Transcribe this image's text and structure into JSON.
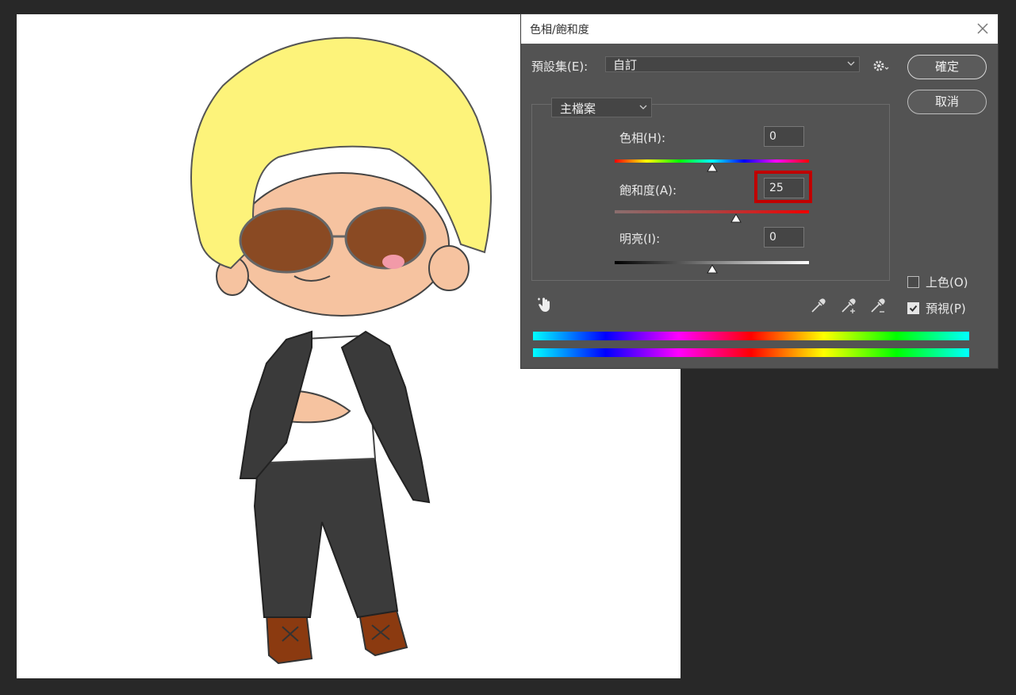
{
  "dialog": {
    "title": "色相/飽和度",
    "preset_label": "預設集(E):",
    "preset_value": "自訂",
    "ok_label": "確定",
    "cancel_label": "取消",
    "channel_value": "主檔案",
    "hue": {
      "label": "色相(H):",
      "value": "0",
      "level": 0.5
    },
    "saturation": {
      "label": "飽和度(A):",
      "value": "25",
      "level": 0.625
    },
    "lightness": {
      "label": "明亮(I):",
      "value": "0",
      "level": 0.5
    },
    "colorize_label": "上色(O)",
    "colorize_checked": false,
    "preview_label": "預視(P)",
    "preview_checked": true,
    "highlight_color": "#c00000"
  },
  "icons": [
    "close-icon",
    "chevron-down-icon",
    "gear-icon",
    "hand-adjust-icon",
    "eyedropper-icon",
    "eyedropper-plus-icon",
    "eyedropper-minus-icon"
  ]
}
